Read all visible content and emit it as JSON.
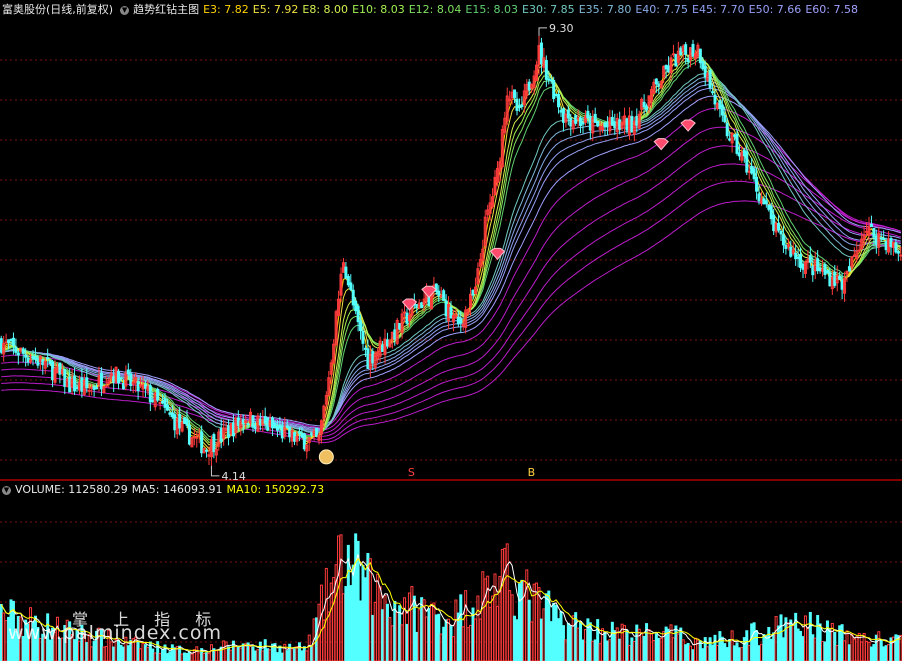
{
  "header": {
    "stock_label": "富奥股份(日线,前复权)",
    "indicator_name": "趋势红钻主图",
    "ema_readouts": [
      {
        "label": "E3: 7.82",
        "color": "#ffd200"
      },
      {
        "label": "E5: 7.92",
        "color": "#f0e040"
      },
      {
        "label": "E8: 8.00",
        "color": "#d0f050"
      },
      {
        "label": "E10: 8.03",
        "color": "#a0f050"
      },
      {
        "label": "E12: 8.04",
        "color": "#80e060"
      },
      {
        "label": "E15: 8.03",
        "color": "#60d070"
      },
      {
        "label": "E30: 7.85",
        "color": "#70c8c0"
      },
      {
        "label": "E35: 7.80",
        "color": "#80b8d8"
      },
      {
        "label": "E40: 7.75",
        "color": "#88a8e8"
      },
      {
        "label": "E45: 7.70",
        "color": "#90a0f0"
      },
      {
        "label": "E50: 7.66",
        "color": "#98a0f8"
      },
      {
        "label": "E60: 7.58",
        "color": "#a0a0ff"
      }
    ]
  },
  "volume_header": {
    "volume_label": "VOLUME: 112580.29",
    "ma5_label": "MA5: 146093.91",
    "ma10_label": "MA10: 150292.73"
  },
  "annotations": {
    "high_label": "9.30",
    "low_label": "4.14",
    "signal_s": "S",
    "signal_b": "B"
  },
  "watermark": {
    "line1": "掌 上 指 标",
    "line2": "www.palmindex.com"
  },
  "colors": {
    "up": "#ff3b3b",
    "down": "#54ffff",
    "grid": "#7a1010",
    "separator": "#b00000",
    "ma5": "#ffffff",
    "ma10": "#ffff00",
    "fast_ema": "#ffff66",
    "slow_ema": "#6f8fff",
    "purple_band": "#d020e0"
  },
  "chart_data": {
    "type": "candlestick",
    "ylim": [
      4.0,
      9.45
    ],
    "high_marker": 9.3,
    "low_marker": 4.14,
    "keypoints": [
      [
        0,
        5.6
      ],
      [
        18,
        5.35
      ],
      [
        28,
        5.1
      ],
      [
        36,
        5.05
      ],
      [
        45,
        5.25
      ],
      [
        60,
        5.0
      ],
      [
        75,
        4.55
      ],
      [
        84,
        4.35
      ],
      [
        100,
        4.72
      ],
      [
        110,
        4.6
      ],
      [
        122,
        4.45
      ],
      [
        130,
        4.45
      ],
      [
        134,
        5.2
      ],
      [
        140,
        6.6
      ],
      [
        145,
        5.9
      ],
      [
        150,
        5.4
      ],
      [
        160,
        5.7
      ],
      [
        170,
        6.05
      ],
      [
        178,
        6.2
      ],
      [
        187,
        5.8
      ],
      [
        194,
        6.2
      ],
      [
        198,
        7.0
      ],
      [
        203,
        7.6
      ],
      [
        207,
        8.6
      ],
      [
        212,
        8.3
      ],
      [
        220,
        9.05
      ],
      [
        230,
        8.3
      ],
      [
        245,
        8.15
      ],
      [
        258,
        8.2
      ],
      [
        275,
        8.95
      ],
      [
        285,
        9.1
      ],
      [
        295,
        8.2
      ],
      [
        305,
        7.7
      ],
      [
        318,
        6.85
      ],
      [
        328,
        6.55
      ],
      [
        345,
        6.3
      ],
      [
        353,
        6.95
      ],
      [
        360,
        6.85
      ],
      [
        368,
        6.65
      ]
    ],
    "vol_keypoints": [
      [
        0,
        46
      ],
      [
        25,
        30
      ],
      [
        50,
        18
      ],
      [
        75,
        10
      ],
      [
        100,
        16
      ],
      [
        125,
        12
      ],
      [
        132,
        58
      ],
      [
        140,
        100
      ],
      [
        150,
        75
      ],
      [
        160,
        55
      ],
      [
        172,
        50
      ],
      [
        185,
        42
      ],
      [
        197,
        68
      ],
      [
        207,
        80
      ],
      [
        218,
        58
      ],
      [
        230,
        38
      ],
      [
        245,
        30
      ],
      [
        258,
        25
      ],
      [
        270,
        28
      ],
      [
        285,
        18
      ],
      [
        300,
        22
      ],
      [
        315,
        30
      ],
      [
        330,
        36
      ],
      [
        345,
        24
      ],
      [
        368,
        18
      ]
    ],
    "vol_ylim": [
      0,
      160
    ],
    "signals": [
      {
        "type": "money-bag",
        "x": 133,
        "y": 4.25
      },
      {
        "type": "diamond",
        "x": 167,
        "y": 6.05
      },
      {
        "type": "diamond",
        "x": 175,
        "y": 6.2
      },
      {
        "type": "diamond",
        "x": 203,
        "y": 6.65
      },
      {
        "type": "diamond",
        "x": 270,
        "y": 7.95
      },
      {
        "type": "diamond",
        "x": 281,
        "y": 8.17
      }
    ],
    "s_signal_x": 168,
    "b_signal_x": 217,
    "n_candles": 369
  }
}
